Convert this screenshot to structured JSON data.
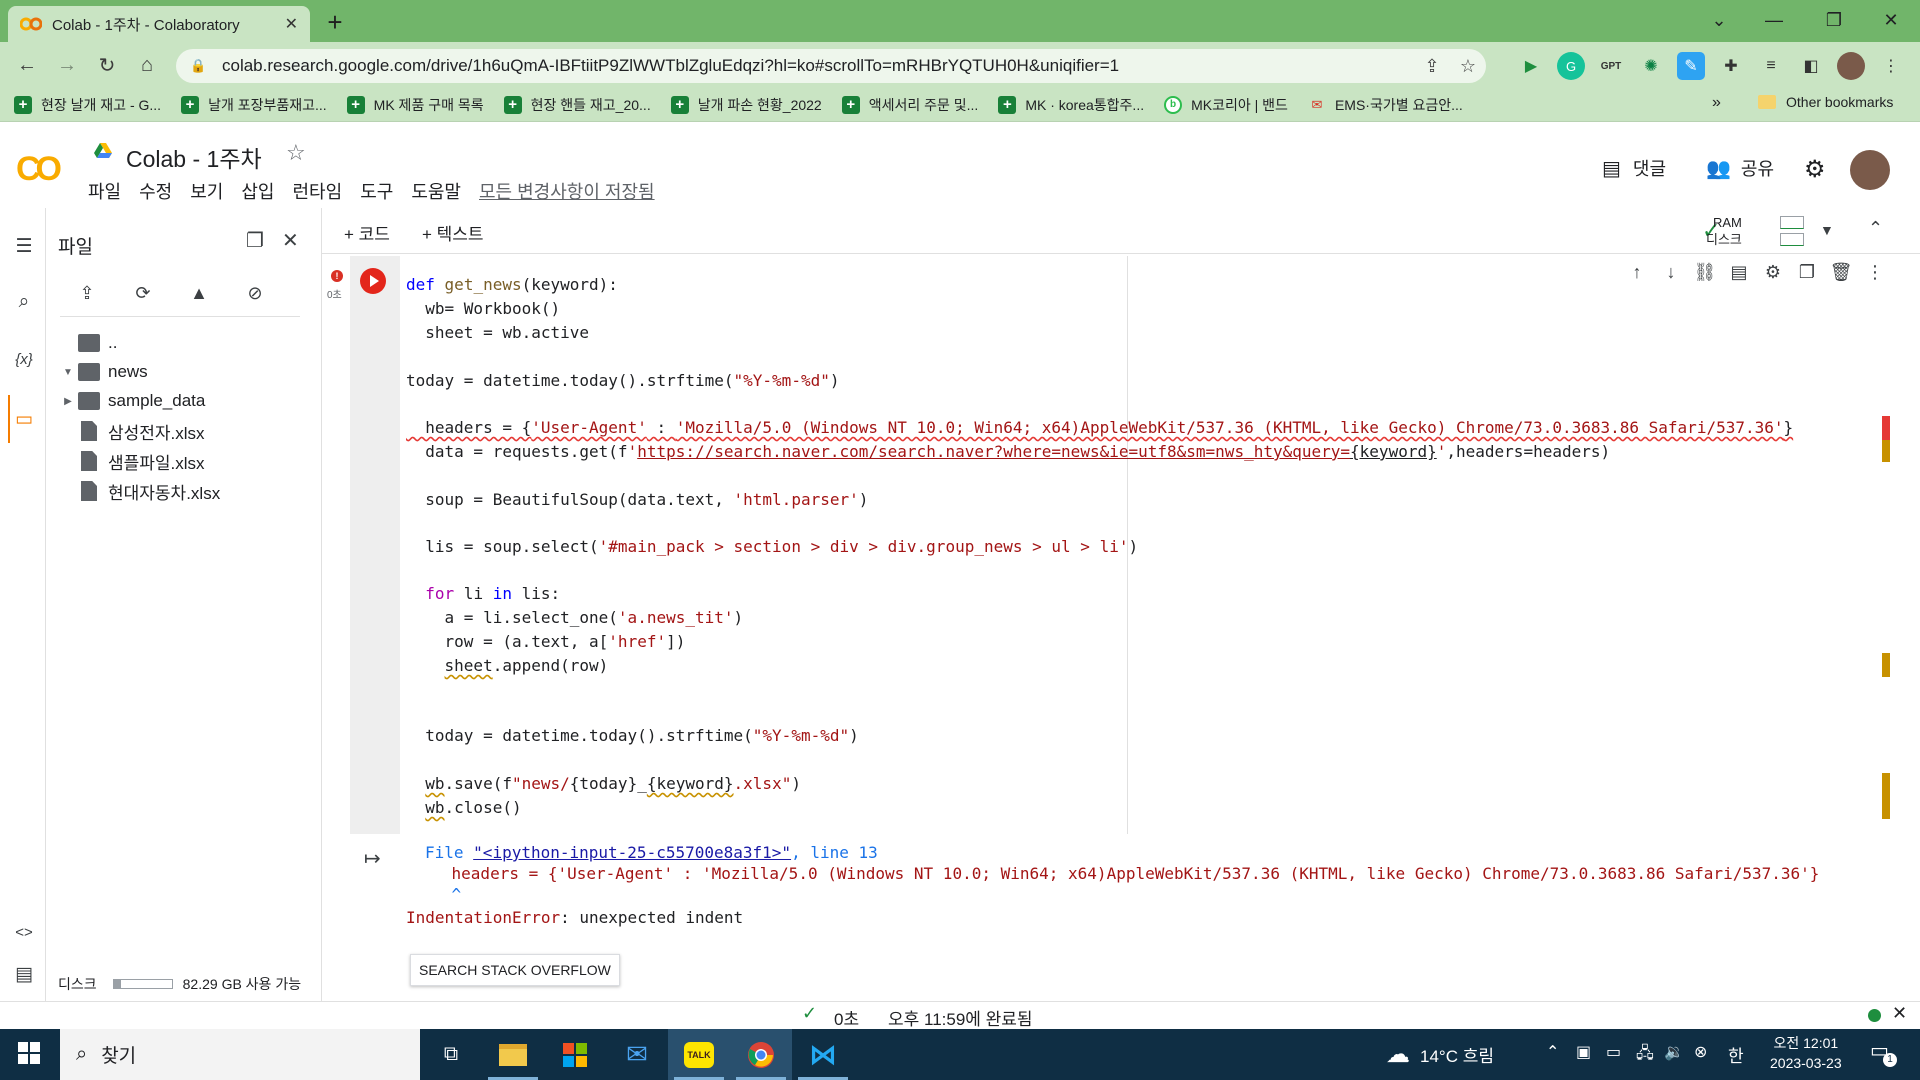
{
  "browser": {
    "tab_title": "Colab - 1주차 - Colaboratory",
    "url": "colab.research.google.com/drive/1h6uQmA-IBFtiitP9ZlWWTblZgluEdqzi?hl=ko#scrollTo=mRHBrYQTUH0H&uniqifier=1",
    "bookmarks": [
      {
        "label": "현장 날개 재고 - G...",
        "icon": "sheets-icon"
      },
      {
        "label": "날개 포장부품재고...",
        "icon": "sheets-icon"
      },
      {
        "label": "MK 제품 구매 목록",
        "icon": "sheets-icon"
      },
      {
        "label": "현장 핸들 재고_20...",
        "icon": "sheets-icon"
      },
      {
        "label": "날개 파손 현황_2022",
        "icon": "sheets-icon"
      },
      {
        "label": "액세서리 주문 및...",
        "icon": "sheets-icon"
      },
      {
        "label": "MK · korea통합주...",
        "icon": "sheets-icon"
      },
      {
        "label": "MK코리아 | 밴드",
        "icon": "band-icon"
      },
      {
        "label": "EMS·국가별 요금안...",
        "icon": "ems-icon"
      }
    ],
    "more_bookmarks": "»",
    "other_bookmarks": "Other bookmarks"
  },
  "colab": {
    "logo": "CO",
    "notebook_title": "Colab - 1주차",
    "menu": [
      "파일",
      "수정",
      "보기",
      "삽입",
      "런타임",
      "도구",
      "도움말"
    ],
    "save_status": "모든 변경사항이 저장됨",
    "comments_label": "댓글",
    "share_label": "공유",
    "add_code": "+ 코드",
    "add_text": "+ 텍스트",
    "ram_label": "RAM",
    "disk_label": "디스크"
  },
  "sidebar": {
    "title": "파일",
    "tree": [
      {
        "name": "..",
        "type": "parent"
      },
      {
        "name": "news",
        "type": "folder",
        "expanded": true
      },
      {
        "name": "sample_data",
        "type": "folder",
        "expanded": false
      },
      {
        "name": "삼성전자.xlsx",
        "type": "file"
      },
      {
        "name": "샘플파일.xlsx",
        "type": "file"
      },
      {
        "name": "현대자동차.xlsx",
        "type": "file"
      }
    ],
    "disk_label": "디스크",
    "disk_usage_fraction": 0.12,
    "disk_free": "82.29 GB 사용 가능"
  },
  "cell": {
    "exec_time": "0초",
    "error_badge": "!",
    "output": {
      "file_prefix": "File ",
      "file_link": "\"<ipython-input-25-c55700e8a3f1>\"",
      "line_sep": ", ",
      "line_label": "line 13",
      "error_line": "    headers = {'User-Agent' : 'Mozilla/5.0 (Windows NT 10.0; Win64; x64)AppleWebKit/537.36 (KHTML, like Gecko) Chrome/73.0.3683.86 Safari/537.36'}",
      "caret": "    ^",
      "error_type": "IndentationError",
      "error_msg": ": unexpected indent"
    },
    "search_stackoverflow": "SEARCH STACK OVERFLOW"
  },
  "status": {
    "elapsed": "0초",
    "completed": "오후 11:59에 완료됨"
  },
  "taskbar": {
    "search_placeholder": "찾기",
    "weather": "14°C 흐림",
    "ime": "한",
    "time": "오전 12:01",
    "date": "2023-03-23",
    "notification_count": "1"
  },
  "colors": {
    "chrome_frame": "#71b56a",
    "chrome_toolbar": "#c9e4c3",
    "run_error": "#e3261b",
    "keyword": "#0000ff",
    "string": "#a31515",
    "taskbar": "#0f2e44"
  }
}
